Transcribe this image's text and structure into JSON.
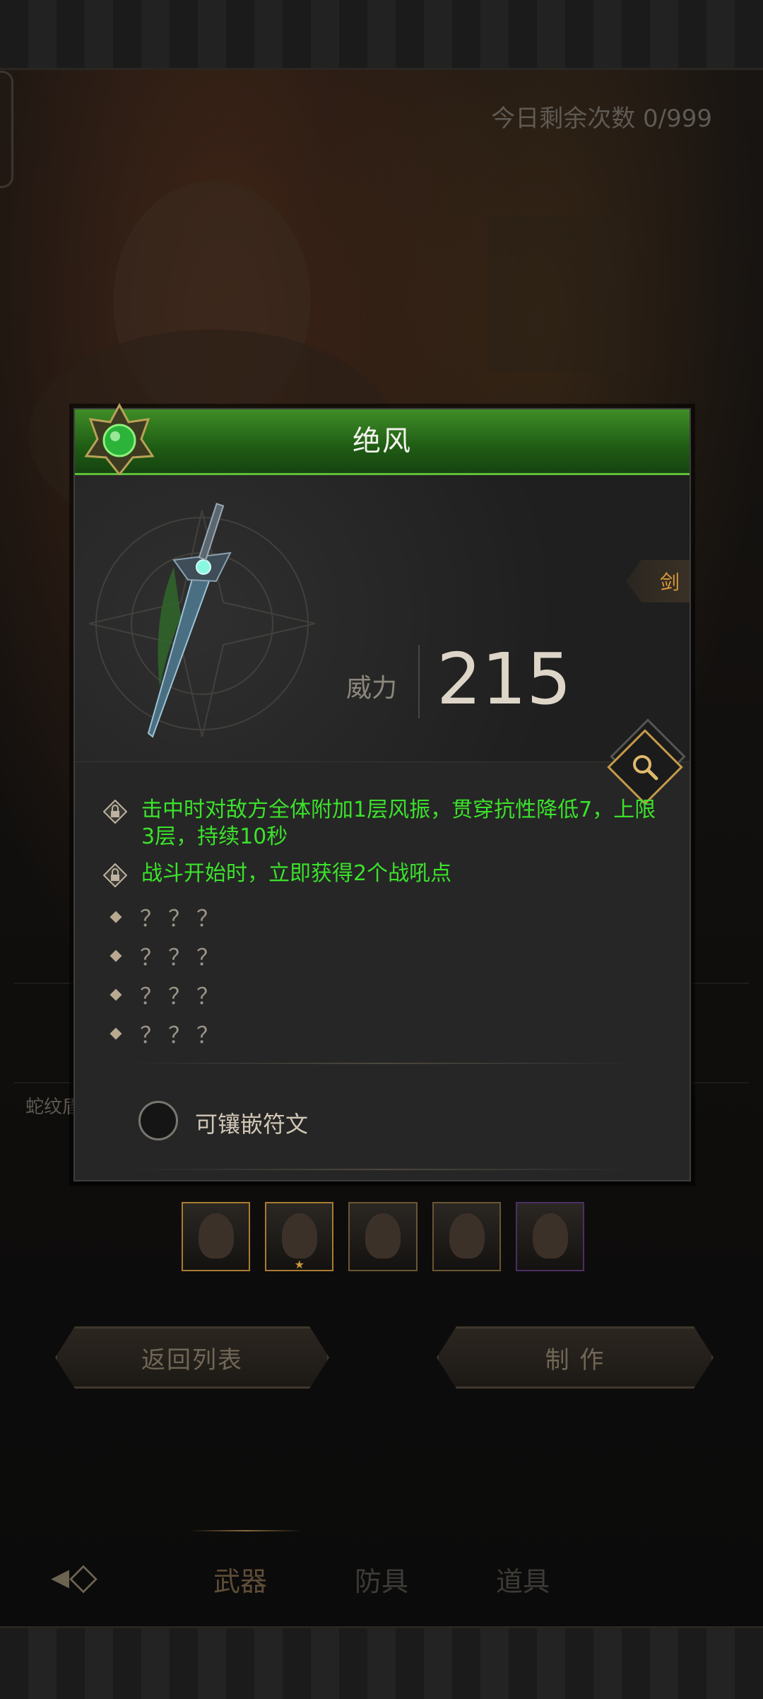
{
  "header": {
    "remaining": "今日剩余次数 0/999"
  },
  "background": {
    "side_label": "蛇纹盾"
  },
  "modal": {
    "title": "绝风",
    "type_tag": "剑",
    "power_label": "威力",
    "power_value": "215",
    "effects": [
      {
        "text": "击中时对敌方全体附加1层风振，贯穿抗性降低7，上限3层，持续10秒",
        "locked": true
      },
      {
        "text": "战斗开始时，立即获得2个战吼点",
        "locked": true
      }
    ],
    "unknown": [
      "？？？",
      "？？？",
      "？？？",
      "？？？"
    ],
    "rune_label": "可镶嵌符文",
    "accent_color": "#3be22b"
  },
  "buttons": {
    "back": "返回列表",
    "make": "制  作"
  },
  "tabs": {
    "weapon": "武器",
    "armor": "防具",
    "item": "道具"
  }
}
